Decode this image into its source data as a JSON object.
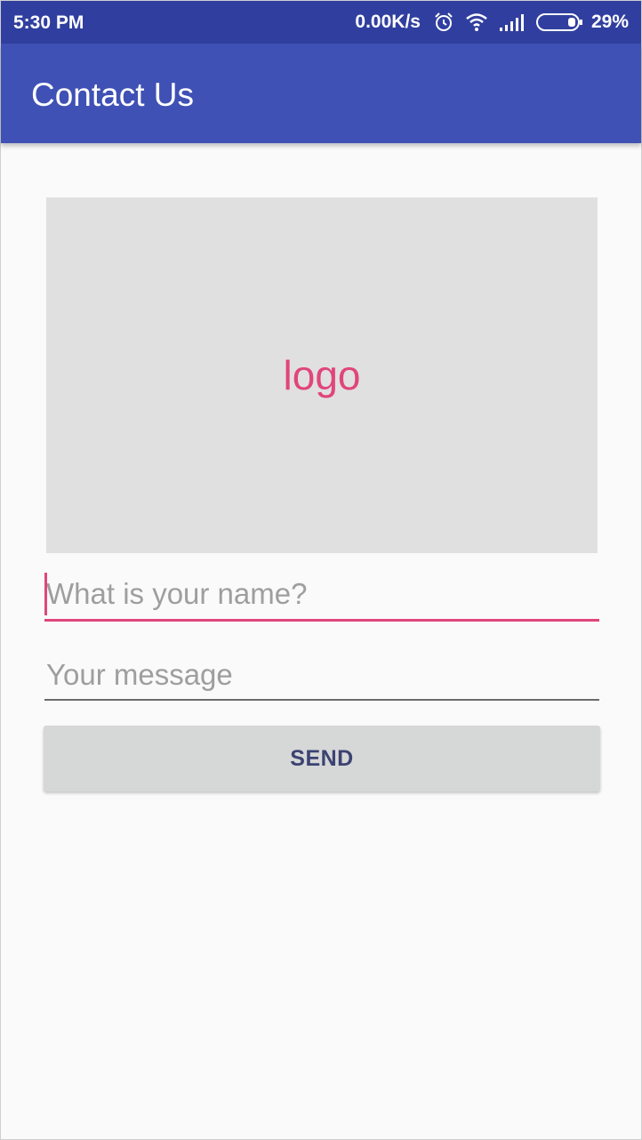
{
  "status_bar": {
    "time": "5:30 PM",
    "network_speed": "0.00K/s",
    "battery_percent": "29%",
    "icons": [
      "alarm-icon",
      "wifi-icon",
      "signal-icon",
      "battery-icon"
    ]
  },
  "app_bar": {
    "title": "Contact Us"
  },
  "logo": {
    "text": "logo"
  },
  "form": {
    "name_placeholder": "What is your name?",
    "message_placeholder": "Your message",
    "send_label": "SEND"
  },
  "colors": {
    "primary": "#3f51b5",
    "primary_dark": "#303f9f",
    "accent": "#e0457b",
    "logo_background": "#e0e0e0",
    "button_background": "#d6d7d7"
  }
}
